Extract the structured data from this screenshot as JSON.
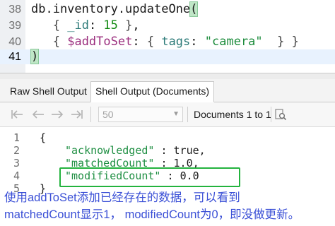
{
  "editor": {
    "lines": [
      {
        "number": "38",
        "text": "db.inventory.updateOne("
      },
      {
        "number": "39",
        "text": "   { _id: 15 },"
      },
      {
        "number": "40",
        "text": "   { $addToSet: { tags: \"camera\"  } }"
      },
      {
        "number": "41",
        "text": ")"
      }
    ],
    "current_line": "41"
  },
  "tabs": [
    {
      "label": "Raw Shell Output",
      "active": false
    },
    {
      "label": "Shell Output (Documents)",
      "active": true
    }
  ],
  "toolbar": {
    "first_icon": "first-page-icon",
    "prev_icon": "previous-page-icon",
    "next_icon": "next-page-icon",
    "last_icon": "last-page-icon",
    "page_size": "50",
    "doc_range": "Documents 1 to 1",
    "find_icon": "search-document-icon"
  },
  "output": {
    "line_numbers": [
      "1",
      "2",
      "3",
      "4",
      "5"
    ],
    "open_brace": "{",
    "fields": [
      {
        "key": "\"acknowledged\"",
        "sep": " : ",
        "value": "true,"
      },
      {
        "key": "\"matchedCount\"",
        "sep": " : ",
        "value": "1.0,"
      },
      {
        "key": "\"modifiedCount\"",
        "sep": " : ",
        "value": "0.0"
      }
    ],
    "close_brace": "}"
  },
  "annotation": {
    "line1": "使用addToSet添加已经存在的数据，可以看到",
    "line2": "matchedCount显示1， modifiedCount为0，即没做更新。",
    "color": "#3a4fd6",
    "box_color": "#23b33e"
  }
}
